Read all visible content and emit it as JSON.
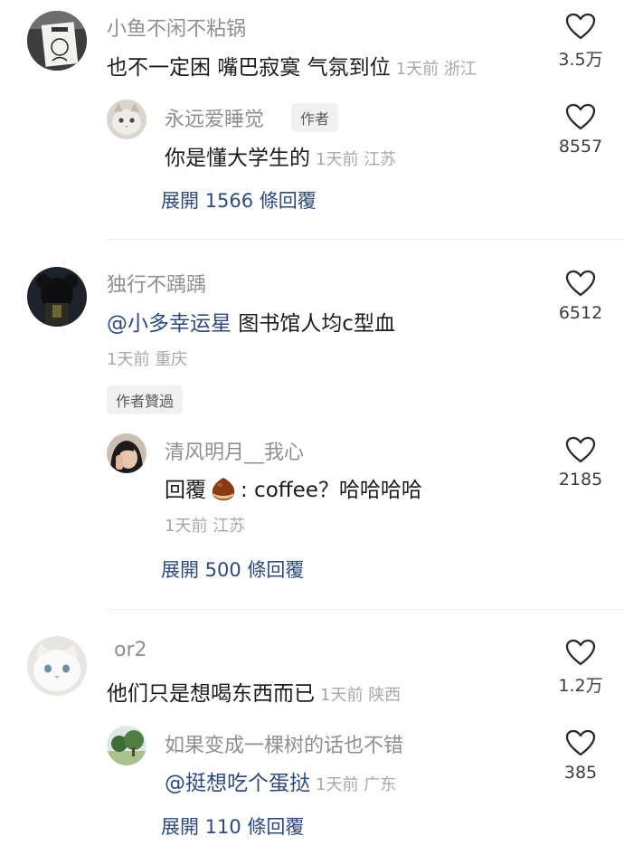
{
  "comments": [
    {
      "user": "小鱼不闲不粘锅",
      "text": "也不一定困 嘴巴寂寞 气氛到位",
      "time": "1天前",
      "location": "浙江",
      "likes": "3.5万",
      "reply": {
        "user": "永远爱睡觉",
        "badge": "作者",
        "text": "你是懂大学生的",
        "time": "1天前",
        "location": "江苏",
        "likes": "8557"
      },
      "expand_label": "展開 1566 條回覆"
    },
    {
      "user": "独行不踽踽",
      "mention": "@小多幸运星",
      "text": " 图书馆人均c型血",
      "time": "1天前",
      "location": "重庆",
      "likes": "6512",
      "author_liked": "作者贊過",
      "reply": {
        "user": "清风明月__我心",
        "text_prefix": "回覆",
        "text": ": coffee？哈哈哈哈",
        "time": "1天前",
        "location": "江苏",
        "likes": "2185"
      },
      "expand_label": "展開 500 條回覆"
    },
    {
      "user": "or2",
      "text": "他们只是想喝东西而已",
      "time": "1天前",
      "location": "陕西",
      "likes": "1.2万",
      "reply": {
        "user": "如果变成一棵树的话也不错",
        "mention": "@挺想吃个蛋挞",
        "time": "1天前",
        "location": "广东",
        "likes": "385"
      },
      "expand_label": "展開 110 條回覆"
    }
  ],
  "colors": {
    "link": "#2e4a7a",
    "meta": "#a8a8a8",
    "username": "#8f8f8f"
  },
  "icons": {
    "like": "heart-outline-icon"
  }
}
